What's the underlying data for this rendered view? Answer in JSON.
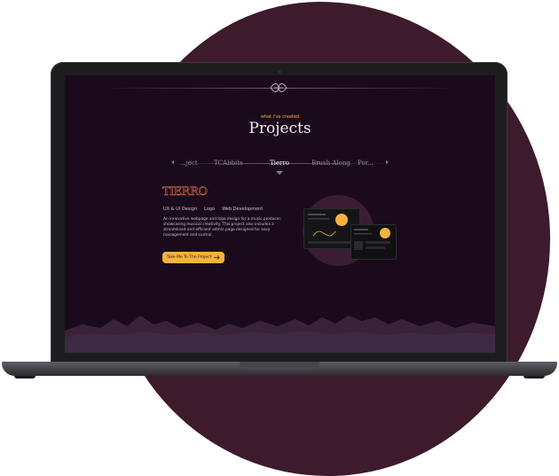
{
  "section": {
    "eyebrow": "what I've created",
    "title": "Projects"
  },
  "tabs": [
    {
      "label": "...ject"
    },
    {
      "label": "TCAbbits"
    },
    {
      "label": "Tierro"
    },
    {
      "label": "Brush Along"
    },
    {
      "label": "Por..."
    }
  ],
  "project": {
    "logo": "TIERRO",
    "tags": [
      "UX & UI Design",
      "Logo",
      "Web Development"
    ],
    "description": "An innovative webpage and logo design for a music producer, showcasing musical creativity. This project also includes a streamlined and efficient admin page designed for easy management and control.",
    "cta": "Take Me To The Project"
  },
  "colors": {
    "accent": "#f4b23f",
    "background": "#1b0a1c",
    "blob": "#3d1a2c"
  }
}
